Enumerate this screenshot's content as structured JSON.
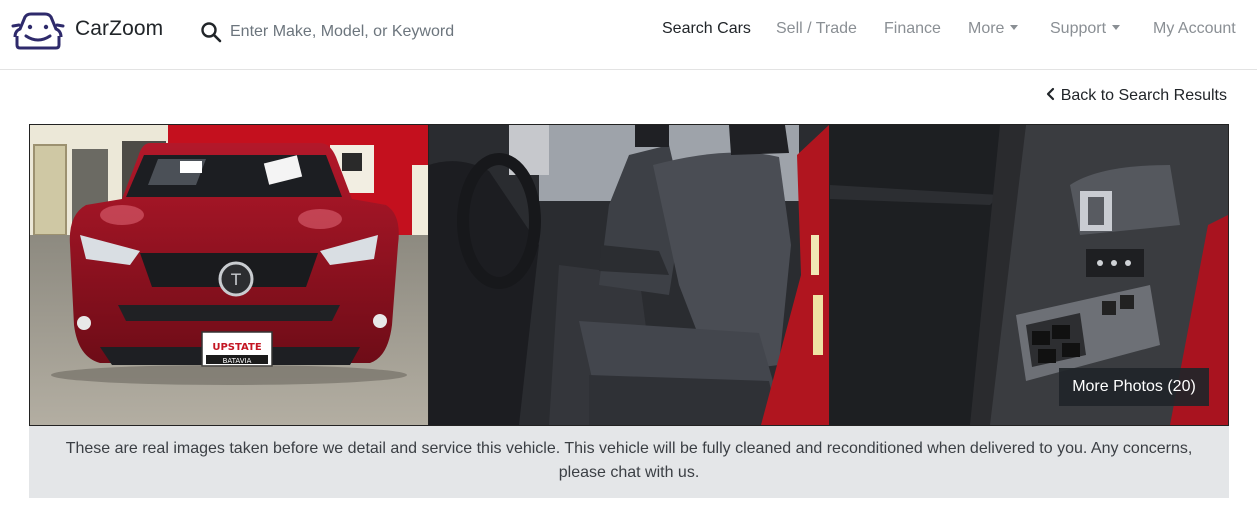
{
  "header": {
    "brand": "CarZoom",
    "search_placeholder": "Enter Make, Model, or Keyword",
    "nav": [
      {
        "label": "Search Cars",
        "active": true
      },
      {
        "label": "Sell / Trade"
      },
      {
        "label": "Finance"
      },
      {
        "label": "More",
        "dropdown": true
      },
      {
        "label": "Support",
        "dropdown": true
      },
      {
        "label": "My Account"
      }
    ],
    "accent": "#2e2a6b"
  },
  "back_link": "Back to Search Results",
  "gallery": {
    "more_photos": "More Photos (20)",
    "photos": [
      "car-front-photo",
      "interior-seat-photo",
      "door-panel-photo"
    ],
    "plate_text": "UPSTATE",
    "plate_subtext": "BATAVIA"
  },
  "disclaimer": "These are real images taken before we detail and service this vehicle. This vehicle will be fully cleaned and reconditioned when delivered to you. Any concerns, please chat with us."
}
